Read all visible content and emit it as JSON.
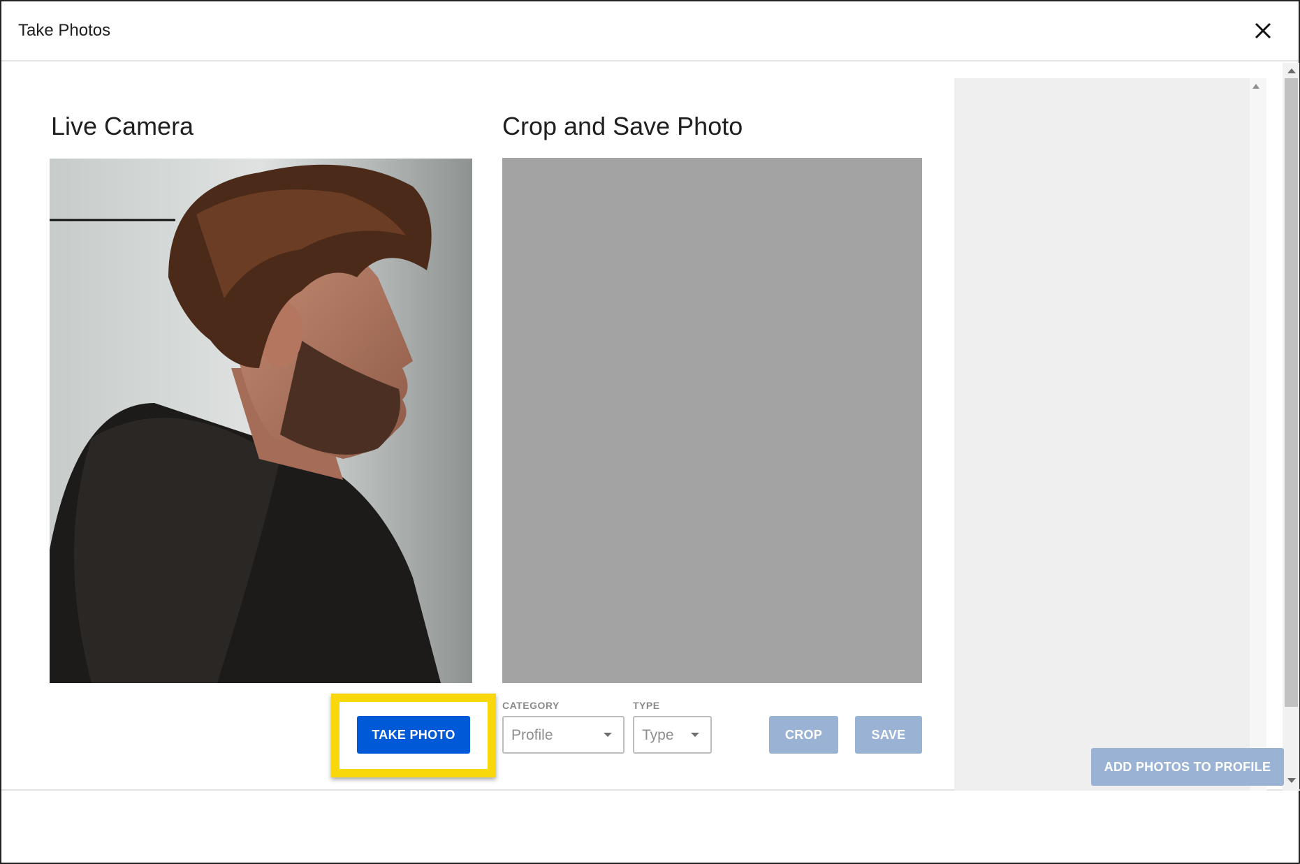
{
  "dialog": {
    "title": "Take Photos",
    "close_icon": "close-icon"
  },
  "live_camera": {
    "heading": "Live Camera",
    "preview": "camera-feed-image",
    "take_photo_label": "TAKE PHOTO",
    "highlight_color": "#f8d80a"
  },
  "crop_panel": {
    "heading": "Crop and Save Photo",
    "category": {
      "label": "CATEGORY",
      "value": "Profile"
    },
    "type": {
      "label": "TYPE",
      "value": "Type"
    },
    "crop_label": "CROP",
    "save_label": "SAVE"
  },
  "footer": {
    "add_photos_label": "ADD PHOTOS TO PROFILE"
  },
  "colors": {
    "primary": "#0059d6",
    "disabled": "#9ab3d4",
    "canvas_gray": "#a3a3a3",
    "panel_gray": "#efefef"
  }
}
